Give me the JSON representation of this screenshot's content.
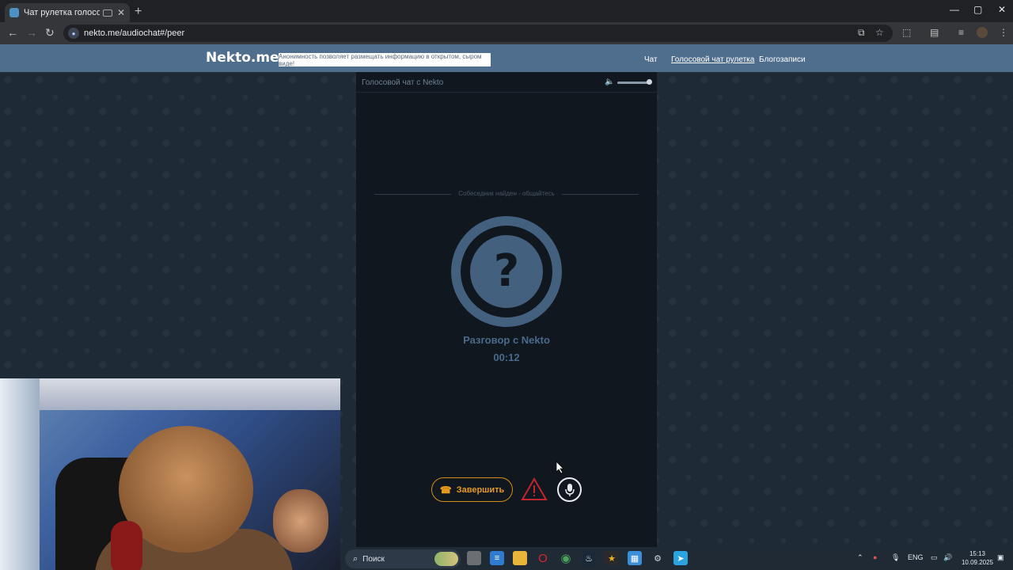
{
  "browser": {
    "tab_title": "Чат рулетка голосовая — Nekto.me",
    "new_tab": "+",
    "tab_close": "✕",
    "url": "nekto.me/audiochat#/peer",
    "window": {
      "minimize": "—",
      "maximize": "▢",
      "close": "✕"
    }
  },
  "site": {
    "logo": "Nekto.me",
    "notice": "Анонимность позволяет размещать информацию в открытом, сыром виде!",
    "nav": [
      {
        "label": "Чат",
        "active": false
      },
      {
        "label": "Голосовой чат рулетка",
        "active": true
      },
      {
        "label": "Блогозаписи",
        "active": false
      }
    ]
  },
  "chat": {
    "panel_title": "Голосовой чат с Nekto",
    "status": "Собеседник найден - общайтесь",
    "avatar_symbol": "?",
    "conversation_label": "Разговор с Nekto",
    "timer": "00:12",
    "end_button": "Завершить",
    "volume": 1.0
  },
  "taskbar": {
    "search_label": "Поиск",
    "language": "ENG",
    "time": "15:13",
    "date": "10.09.2025"
  },
  "colors": {
    "header": "#4f6e8e",
    "panel": "#10171e",
    "avatar": "#44607f",
    "end_button": "#e79a1d",
    "report": "#c0262b"
  }
}
